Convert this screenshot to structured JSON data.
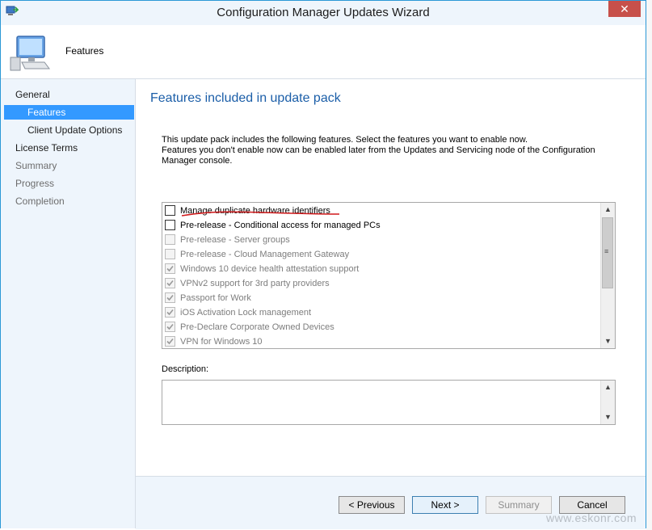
{
  "window": {
    "title": "Configuration Manager Updates Wizard",
    "close_glyph": "✕",
    "icon": "wizard-app-icon"
  },
  "header": {
    "title": "Features",
    "icon": "computer-icon"
  },
  "nav": {
    "items": [
      {
        "label": "General",
        "state": "normal"
      },
      {
        "label": "Features",
        "state": "selected"
      },
      {
        "label": "Client Update Options",
        "state": "normal"
      },
      {
        "label": "License Terms",
        "state": "normal"
      },
      {
        "label": "Summary",
        "state": "disabled"
      },
      {
        "label": "Progress",
        "state": "disabled"
      },
      {
        "label": "Completion",
        "state": "disabled"
      }
    ]
  },
  "main": {
    "heading": "Features included in update pack",
    "intro_lines": [
      "This update pack includes the following features. Select the features you want to enable now.",
      "Features you don't enable now can be enabled later from the Updates and Servicing node of the Configuration",
      "Manager console."
    ],
    "features": [
      {
        "label": "Manage duplicate hardware identifiers",
        "checked": false,
        "enabled": true
      },
      {
        "label": "Pre-release - Conditional access for managed PCs",
        "checked": false,
        "enabled": true
      },
      {
        "label": "Pre-release - Server groups",
        "checked": false,
        "enabled": false
      },
      {
        "label": "Pre-release - Cloud Management Gateway",
        "checked": false,
        "enabled": false
      },
      {
        "label": "Windows 10 device health attestation support",
        "checked": true,
        "enabled": false
      },
      {
        "label": "VPNv2 support for 3rd party providers",
        "checked": true,
        "enabled": false
      },
      {
        "label": "Passport for Work",
        "checked": true,
        "enabled": false
      },
      {
        "label": "iOS Activation Lock management",
        "checked": true,
        "enabled": false
      },
      {
        "label": "Pre-Declare Corporate Owned Devices",
        "checked": true,
        "enabled": false
      },
      {
        "label": "VPN for Windows 10",
        "checked": true,
        "enabled": false
      }
    ],
    "description_label": "Description:",
    "description_value": ""
  },
  "footer": {
    "previous_label": "< Previous",
    "next_label": "Next >",
    "summary_label": "Summary",
    "cancel_label": "Cancel"
  },
  "watermark": "www.eskonr.com",
  "colors": {
    "accent": "#3399ff",
    "heading": "#1b5ea8",
    "annotation": "#d0191b",
    "close": "#c7504a"
  }
}
